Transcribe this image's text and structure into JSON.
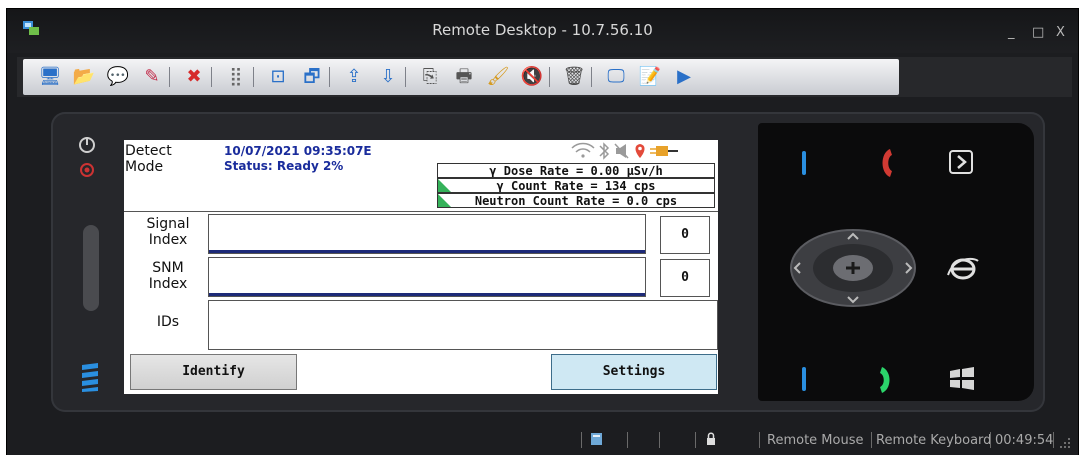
{
  "window": {
    "title": "Remote Desktop - 10.7.56.10",
    "controls": {
      "minimize": "_",
      "maximize": "□",
      "close": "X"
    }
  },
  "toolbar": {
    "buttons": [
      {
        "icon": "connect-icon",
        "glyph": "🖥"
      },
      {
        "icon": "open-folder-icon",
        "glyph": "📂"
      },
      {
        "icon": "bubble-icon",
        "glyph": "💬"
      },
      {
        "icon": "pen-icon",
        "glyph": "✎"
      },
      {
        "icon": "disconnect-icon",
        "glyph": "✖"
      },
      {
        "icon": "grid-icon",
        "glyph": "⣿"
      },
      {
        "icon": "fit-screen-icon",
        "glyph": "⊡"
      },
      {
        "icon": "full-screen-icon",
        "glyph": "🗗"
      },
      {
        "icon": "upload-icon",
        "glyph": "⇪"
      },
      {
        "icon": "download-icon",
        "glyph": "⇩"
      },
      {
        "icon": "copy-icon",
        "glyph": "⎘"
      },
      {
        "icon": "device-icon",
        "glyph": "🖶"
      },
      {
        "icon": "paint-icon",
        "glyph": "🖌"
      },
      {
        "icon": "mute-icon",
        "glyph": "🔇"
      },
      {
        "icon": "trash-icon",
        "glyph": "🗑"
      },
      {
        "icon": "monitor-icon",
        "glyph": "🖵"
      },
      {
        "icon": "edit-icon",
        "glyph": "📝"
      },
      {
        "icon": "play-icon",
        "glyph": "▶"
      }
    ]
  },
  "screen": {
    "mode_label_1": "Detect",
    "mode_label_2": "Mode",
    "datetime": "10/07/2021 09:35:07E",
    "status": "Status: Ready 2%",
    "dose_rate": "γ Dose Rate = 0.00  μSv/h",
    "count_rate": "γ Count Rate = 134 cps",
    "neutron_rate": "Neutron Count Rate = 0.0 cps",
    "signal_index_label_1": "Signal",
    "signal_index_label_2": "Index",
    "signal_index_value": "0",
    "snm_index_label_1": "SNM",
    "snm_index_label_2": "Index",
    "snm_index_value": "0",
    "ids_label": "IDs",
    "identify_button": "Identify",
    "settings_button": "Settings"
  },
  "statusbar": {
    "remote_mouse": "Remote Mouse",
    "remote_keyboard": "Remote Keyboard",
    "time": "00:49:54"
  },
  "colors": {
    "accent_blue": "#1a2c9c",
    "call_green": "#2bd46a",
    "end_red": "#d13a33",
    "phone_blue": "#2a8fe0"
  }
}
